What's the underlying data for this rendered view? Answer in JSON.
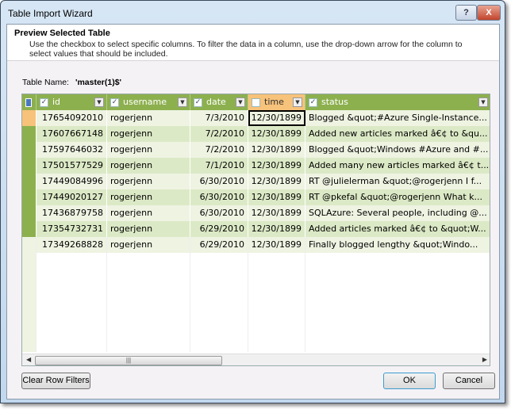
{
  "window": {
    "title": "Table Import Wizard",
    "help_label": "?",
    "close_label": "X"
  },
  "header": {
    "title": "Preview Selected Table",
    "description": "Use the checkbox to select specific columns. To filter the data in a column, use the drop-down arrow  for the column to select values that should be included."
  },
  "table_name": {
    "label": "Table Name:",
    "value": "'master(1)$'"
  },
  "columns": [
    {
      "label": "id",
      "checked": true
    },
    {
      "label": "username",
      "checked": true,
      "filtered": true
    },
    {
      "label": "date",
      "checked": true
    },
    {
      "label": "time",
      "checked": false
    },
    {
      "label": "status",
      "checked": true
    }
  ],
  "rows": [
    [
      "17654092010",
      "rogerjenn",
      "7/3/2010",
      "12/30/1899",
      "Blogged &quot;#Azure Single-Instance..."
    ],
    [
      "17607667148",
      "rogerjenn",
      "7/2/2010",
      "12/30/1899",
      "Added new articles marked â€¢ to &qu..."
    ],
    [
      "17597646032",
      "rogerjenn",
      "7/2/2010",
      "12/30/1899",
      "Blogged &quot;Windows #Azure and #..."
    ],
    [
      "17501577529",
      "rogerjenn",
      "7/1/2010",
      "12/30/1899",
      "Added many new articles marked â€¢ t..."
    ],
    [
      "17449084996",
      "rogerjenn",
      "6/30/2010",
      "12/30/1899",
      "RT @julielerman &quot;@rogerjenn I f..."
    ],
    [
      "17449020127",
      "rogerjenn",
      "6/30/2010",
      "12/30/1899",
      "RT @pkefal &quot;@rogerjenn What k..."
    ],
    [
      "17436879758",
      "rogerjenn",
      "6/30/2010",
      "12/30/1899",
      "SQLAzure: Several people, including @..."
    ],
    [
      "17354732731",
      "rogerjenn",
      "6/29/2010",
      "12/30/1899",
      "Added articles marked â€¢ to &quot;W..."
    ],
    [
      "17349268828",
      "rogerjenn",
      "6/29/2010",
      "12/30/1899",
      "Finally blogged lengthy &quot;Windo..."
    ]
  ],
  "buttons": {
    "clear_filters": "Clear Row Filters",
    "ok": "OK",
    "cancel": "Cancel"
  }
}
